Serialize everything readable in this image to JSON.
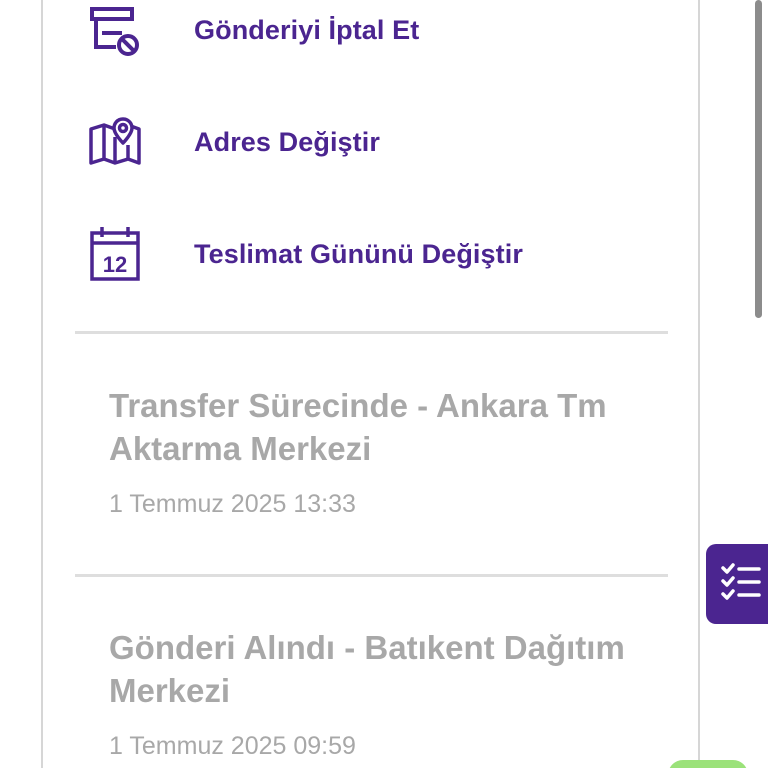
{
  "actions": [
    {
      "label": "Gönderiyi İptal Et",
      "icon": "cancel-shipment-icon"
    },
    {
      "label": "Adres Değiştir",
      "icon": "map-pin-icon"
    },
    {
      "label": "Teslimat Gününü Değiştir",
      "icon": "calendar-icon",
      "icon_text": "12"
    }
  ],
  "events": [
    {
      "title": "Transfer Sürecinde - Ankara Tm Aktarma Merkezi",
      "time": "1 Temmuz 2025 13:33"
    },
    {
      "title": "Gönderi Alındı - Batıkent Dağıtım Merkezi",
      "time": "1 Temmuz 2025 09:59"
    }
  ],
  "floating_button": {
    "icon": "checklist-icon"
  },
  "colors": {
    "accent": "#4b2590",
    "muted_text": "#a8a8a8",
    "divider": "#dedede",
    "green": "#9be27a"
  }
}
